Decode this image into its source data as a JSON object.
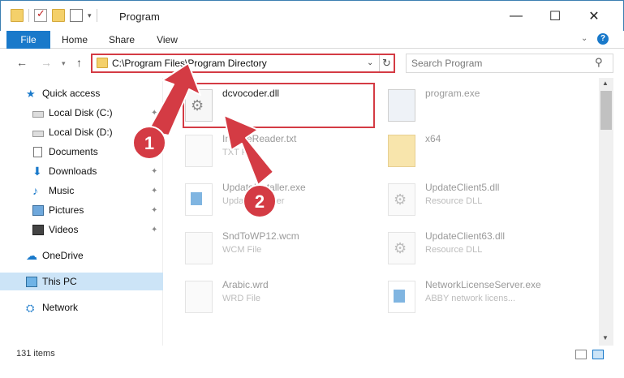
{
  "window": {
    "title": "Program",
    "minimize_glyph": "—",
    "maximize_glyph": "☐",
    "close_glyph": "✕"
  },
  "ribbon": {
    "tabs": [
      "File",
      "Home",
      "Share",
      "View"
    ],
    "help_glyph": "?",
    "expand_glyph": "⌄"
  },
  "nav": {
    "back_glyph": "←",
    "forward_glyph": "→",
    "recent_glyph": "▾",
    "up_glyph": "↑"
  },
  "address": {
    "path": "C:\\Program Files\\Program Directory",
    "dropdown_glyph": "⌄",
    "refresh_glyph": "↻"
  },
  "search": {
    "placeholder": "Search Program",
    "icon_glyph": "⚲"
  },
  "sidebar": {
    "items": [
      {
        "label": "Quick access",
        "icon": "star-icon",
        "pinned": false
      },
      {
        "label": "Local Disk (C:)",
        "icon": "disk-icon",
        "pinned": true
      },
      {
        "label": "Local Disk (D:)",
        "icon": "disk-icon",
        "pinned": false
      },
      {
        "label": "Documents",
        "icon": "document-icon",
        "pinned": false
      },
      {
        "label": "Downloads",
        "icon": "download-icon",
        "pinned": true
      },
      {
        "label": "Music",
        "icon": "music-icon",
        "pinned": true
      },
      {
        "label": "Pictures",
        "icon": "pictures-icon",
        "pinned": true
      },
      {
        "label": "Videos",
        "icon": "videos-icon",
        "pinned": true
      },
      {
        "label": "OneDrive",
        "icon": "cloud-icon",
        "pinned": false
      },
      {
        "label": "This PC",
        "icon": "computer-icon",
        "pinned": false,
        "selected": true
      },
      {
        "label": "Network",
        "icon": "network-icon",
        "pinned": false
      }
    ],
    "pin_glyph": "📌"
  },
  "files": [
    {
      "name": "dcvocoder.dll",
      "type": "",
      "icon": "dll-gear-icon",
      "highlighted": true
    },
    {
      "name": "program.exe",
      "type": "",
      "icon": "exe-icon"
    },
    {
      "name": "ImFineReader.txt",
      "type": "TXT File",
      "icon": "text-file-icon"
    },
    {
      "name": "x64",
      "type": "",
      "icon": "folder-icon"
    },
    {
      "name": "UpdateInstaller.exe",
      "type": "Update installer",
      "icon": "installer-icon"
    },
    {
      "name": "UpdateClient5.dll",
      "type": "Resource DLL",
      "icon": "dll-gear-icon"
    },
    {
      "name": "SndToWP12.wcm",
      "type": "WCM File",
      "icon": "file-icon"
    },
    {
      "name": "UpdateClient63.dll",
      "type": "Resource DLL",
      "icon": "dll-gear-icon"
    },
    {
      "name": "Arabic.wrd",
      "type": "WRD File",
      "icon": "file-icon"
    },
    {
      "name": "NetworkLicenseServer.exe",
      "type": "ABBY network licens...",
      "icon": "installer-icon"
    }
  ],
  "annotations": {
    "step1": "1",
    "step2": "2",
    "color": "#d43b44"
  },
  "status": {
    "item_count": "131 items"
  },
  "colors": {
    "accent": "#1979ca",
    "highlight": "#d43b44",
    "selected_bg": "#cce4f7"
  }
}
